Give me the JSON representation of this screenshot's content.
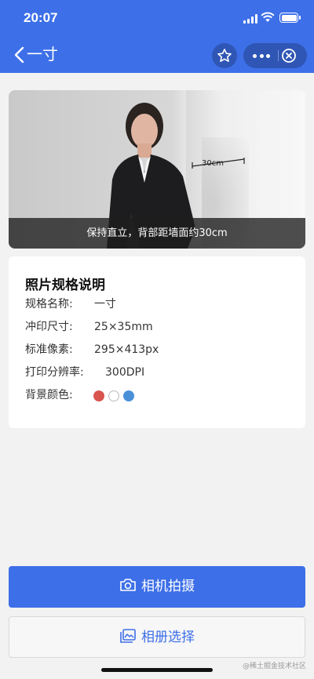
{
  "status": {
    "time": "20:07"
  },
  "nav": {
    "title": "一寸"
  },
  "photo": {
    "caption": "保持直立，背部距墙面约30cm",
    "measure_label": "30cm"
  },
  "spec": {
    "title": "照片规格说明",
    "rows": [
      {
        "label": "规格名称:",
        "value": "一寸"
      },
      {
        "label": "冲印尺寸:",
        "value": "25×35mm"
      },
      {
        "label": "标准像素:",
        "value": "295×413px"
      },
      {
        "label": "打印分辨率:",
        "value": "300DPI"
      },
      {
        "label": "背景颜色:",
        "value": ""
      }
    ],
    "bg_colors": [
      "#d9534f",
      "#ffffff",
      "#4a90d9"
    ]
  },
  "buttons": {
    "camera": "相机拍摄",
    "album": "相册选择"
  },
  "watermark": "@稀土掘金技术社区",
  "colors": {
    "accent": "#3d6fe8"
  }
}
